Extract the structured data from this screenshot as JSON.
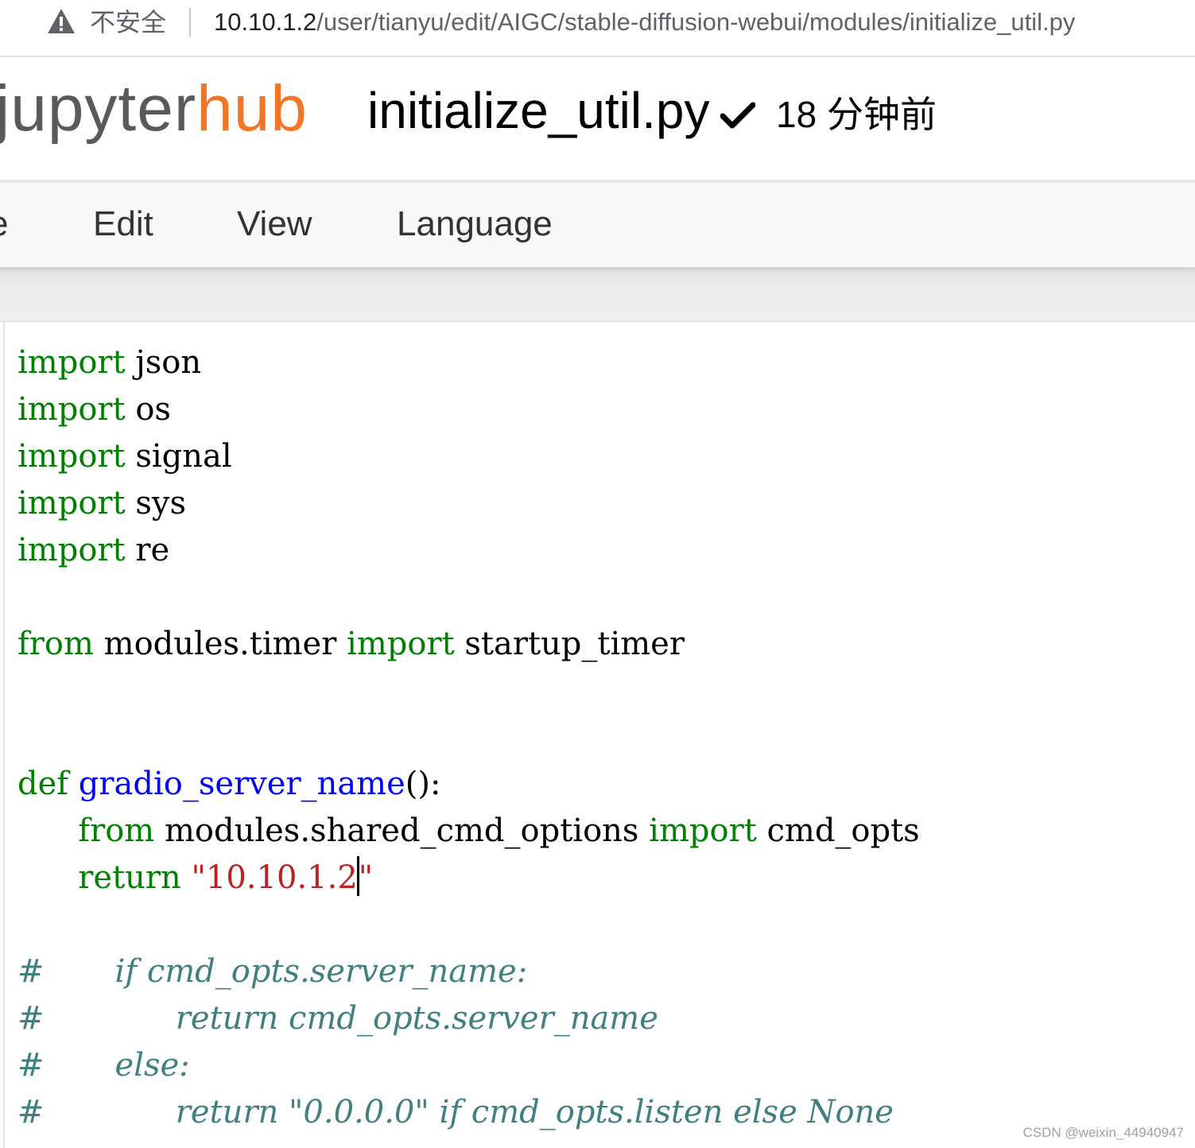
{
  "browser": {
    "security_label": "不安全",
    "url_host": "10.10.1.2",
    "url_path": "/user/tianyu/edit/AIGC/stable-diffusion-webui/modules/initialize_util.py"
  },
  "header": {
    "logo_part1": "jupyter",
    "logo_part2": "hub",
    "filename": "initialize_util.py",
    "saved_time": "18 分钟前"
  },
  "menu": {
    "items": [
      "e",
      "Edit",
      "View",
      "Language"
    ]
  },
  "code": {
    "lines": [
      {
        "kw": "import",
        "rest": " json"
      },
      {
        "kw": "import",
        "rest": " os"
      },
      {
        "kw": "import",
        "rest": " signal"
      },
      {
        "kw": "import",
        "rest": " sys"
      },
      {
        "kw": "import",
        "rest": " re"
      },
      {
        "from_kw": "from",
        "module": " modules.timer ",
        "import_kw": "import",
        "name": " startup_timer"
      },
      {
        "def_kw": "def",
        "func": " gradio_server_name",
        "sig": "():"
      },
      {
        "indent": "      ",
        "from_kw": "from",
        "module": " modules.shared_cmd_options ",
        "import_kw": "import",
        "name": " cmd_opts"
      },
      {
        "indent": "      ",
        "return_kw": "return",
        "string_before_cursor": " \"10.10.1.2",
        "string_after_cursor": "\""
      },
      {
        "comment": "#       if cmd_opts.server_name:"
      },
      {
        "comment": "#             return cmd_opts.server_name"
      },
      {
        "comment": "#       else:"
      },
      {
        "comment": "#             return \"0.0.0.0\" if cmd_opts.listen else None"
      }
    ]
  },
  "colors": {
    "keyword": "#008000",
    "function_name": "#0000ff",
    "string": "#ba2121",
    "comment": "#408080",
    "hub_orange": "#f37626"
  },
  "watermark": "CSDN @weixin_44940947"
}
